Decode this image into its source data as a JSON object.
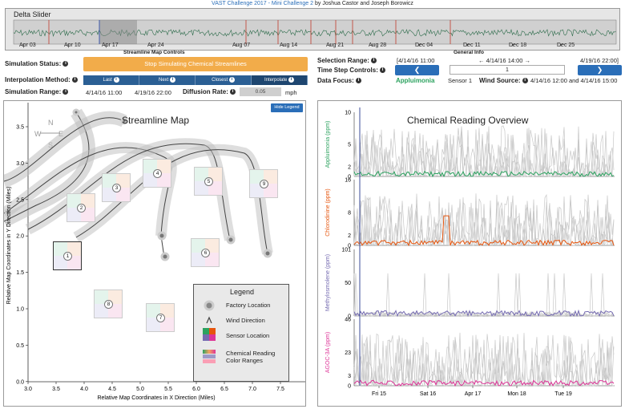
{
  "header": {
    "title_blue": "VAST Challenge 2017 - Mini Challenge 2",
    "byline": " by Joshua Castor and Joseph Borowicz"
  },
  "slider": {
    "title": "Delta Slider",
    "dates": [
      "Apr 03",
      "Apr 10",
      "Apr 17",
      "Apr 24",
      "Aug 07",
      "Aug 14",
      "Aug 21",
      "Aug 28",
      "Dec 04",
      "Dec 11",
      "Dec 18",
      "Dec 25"
    ]
  },
  "controls": {
    "section_title": "Streamline Map Controls",
    "sim_status_label": "Simulation Status:",
    "sim_button": "Stop Simulating Chemical Streamlines",
    "interp_label": "Interpolation Method:",
    "interp_options": [
      "Last",
      "Next",
      "Closest",
      "Interpolate"
    ],
    "range_label": "Simulation Range:",
    "range_start": "4/14/16 11:00",
    "range_end": "4/19/16 22:00",
    "rate_label": "Diffusion Rate:",
    "rate_value": "0.05",
    "rate_unit": "mph"
  },
  "general": {
    "section_title": "General Info",
    "sel_label": "Selection Range:",
    "sel_start": "[4/14/16 11:00",
    "sel_mid": "← 4/14/16 14:00 →",
    "sel_end": "4/19/16 22:00]",
    "step_label": "Time Step Controls:",
    "step_value": "1",
    "prev_icon": "❮",
    "next_icon": "❯",
    "focus_label": "Data Focus:",
    "focus_chem": "Appluimonia",
    "focus_sensor": "Sensor 1",
    "wind_label": "Wind Source:",
    "wind_value": "4/14/16 12:00 and 4/14/16 15:00"
  },
  "map": {
    "title": "Streamline Map",
    "hide_legend": "Hide Legend",
    "xlabel": "Relative Map Coordinates in X Direction (Miles)",
    "ylabel": "Relative Map Coordinates in Y Direction (Miles)",
    "xticks": [
      "3.0",
      "3.5",
      "4.0",
      "4.5",
      "5.0",
      "5.5",
      "6.0",
      "6.5",
      "7.0",
      "7.5"
    ],
    "yticks": [
      "3.5",
      "3.0",
      "2.5",
      "2.0",
      "1.5",
      "1.0",
      "0.5",
      "0.0"
    ],
    "compass": {
      "n": "N",
      "w": "W",
      "e": "E",
      "s": "S"
    },
    "legend": {
      "title": "Legend",
      "factory": "Factory Location",
      "wind": "Wind Direction",
      "sensor": "Sensor Location",
      "ranges1": "Chemical Reading",
      "ranges2": "Color Ranges"
    },
    "sensors": [
      "1",
      "2",
      "3",
      "4",
      "5",
      "6",
      "7",
      "8",
      "9"
    ]
  },
  "chart_data": {
    "type": "line",
    "title": "Chemical Reading Overview",
    "x_ticks": [
      "Fri 15",
      "Sat 16",
      "Apr 17",
      "Mon 18",
      "Tue 19"
    ],
    "panels": [
      {
        "name": "Appluimonia (ppm)",
        "color": "#2ca25f",
        "yticks": [
          "10",
          "5",
          "2",
          "0"
        ]
      },
      {
        "name": "Chlorodinine (ppm)",
        "color": "#e6550d",
        "yticks": [
          "16",
          "8",
          "2",
          "0"
        ]
      },
      {
        "name": "Methylosmolene (ppm)",
        "color": "#756bb1",
        "yticks": [
          "101",
          "50",
          "0"
        ]
      },
      {
        "name": "AGOC-3A (ppm)",
        "color": "#dd3497",
        "yticks": [
          "46",
          "23",
          "3",
          "0"
        ]
      }
    ]
  }
}
